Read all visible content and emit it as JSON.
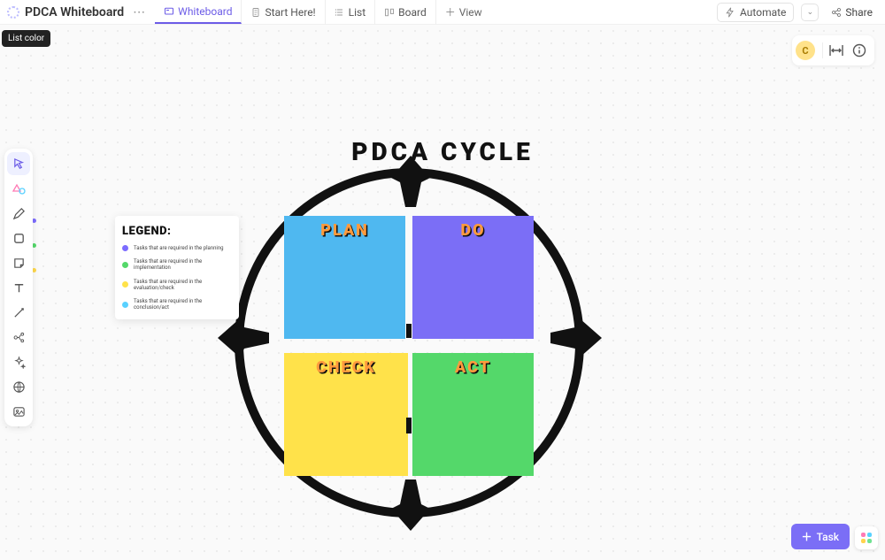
{
  "header": {
    "title": "PDCA Whiteboard",
    "tooltip": "List color",
    "automate": "Automate",
    "share": "Share",
    "avatar_initial": "C"
  },
  "tabs": {
    "whiteboard": "Whiteboard",
    "start_here": "Start Here!",
    "list": "List",
    "board": "Board",
    "view": "View"
  },
  "cycle": {
    "title": "PDCA CYCLE",
    "plan": "PLAN",
    "do": "DO",
    "check": "CHECK",
    "act": "ACT"
  },
  "legend": {
    "title": "LEGEND:",
    "rows": [
      {
        "color": "#7c6cff",
        "text": "Tasks that are required in the planning"
      },
      {
        "color": "#54d86a",
        "text": "Tasks that are required in the implementation"
      },
      {
        "color": "#ffe24a",
        "text": "Tasks that are required in the evaluation/check"
      },
      {
        "color": "#59d1ff",
        "text": "Tasks that are required in the conclusion/act"
      }
    ]
  },
  "bottom": {
    "task": "Task"
  }
}
